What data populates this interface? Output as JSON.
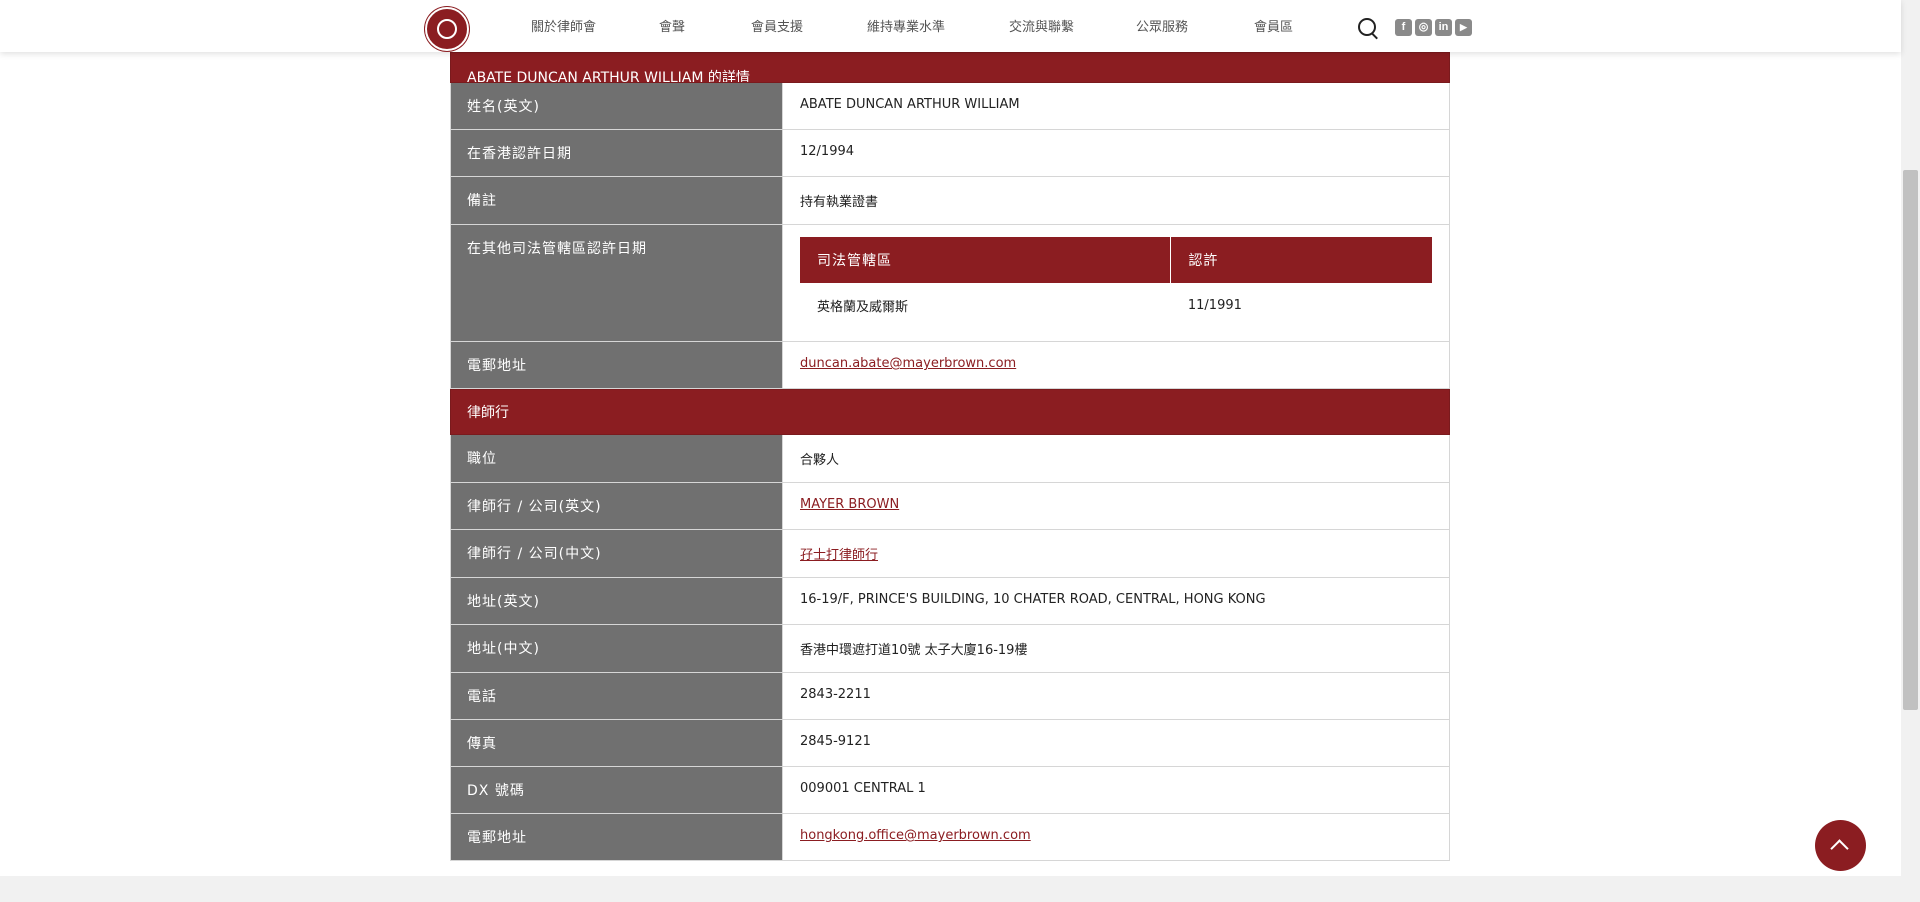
{
  "nav": {
    "items": [
      "關於律師會",
      "會聲",
      "會員支援",
      "維持專業水準",
      "交流與聯繫",
      "公眾服務",
      "會員區"
    ],
    "social": [
      "f",
      "◎",
      "in",
      "▶"
    ]
  },
  "profile": {
    "heading": "ABATE DUNCAN ARTHUR WILLIAM 的詳情",
    "rows": [
      {
        "label": "姓名(英文)",
        "value": "ABATE DUNCAN ARTHUR WILLIAM"
      },
      {
        "label": "在香港認許日期",
        "value": "12/1994"
      },
      {
        "label": "備註",
        "value": "持有執業證書"
      }
    ],
    "other_jurisdictions": {
      "label": "在其他司法管轄區認許日期",
      "col_jurisdiction": "司法管轄區",
      "col_admission": "認許",
      "entries": [
        {
          "jurisdiction": "英格蘭及威爾斯",
          "admission": "11/1991"
        }
      ]
    },
    "email": {
      "label": "電郵地址",
      "value": "duncan.abate@mayerbrown.com"
    }
  },
  "firm": {
    "heading": "律師行",
    "position": {
      "label": "職位",
      "value": "合夥人"
    },
    "name_en": {
      "label": "律師行 / 公司(英文)",
      "value": "MAYER BROWN"
    },
    "name_zh": {
      "label": "律師行 / 公司(中文)",
      "value": "孖士打律師行"
    },
    "addr_en": {
      "label": "地址(英文)",
      "value": "16-19/F, PRINCE'S BUILDING, 10 CHATER ROAD, CENTRAL, HONG KONG"
    },
    "addr_zh": {
      "label": "地址(中文)",
      "value": "香港中環遮打道10號 太子大廈16-19樓"
    },
    "phone": {
      "label": "電話",
      "value": "2843-2211"
    },
    "fax": {
      "label": "傳真",
      "value": "2845-9121"
    },
    "dx": {
      "label": "DX 號碼",
      "value": "009001 CENTRAL 1"
    },
    "email": {
      "label": "電郵地址",
      "value": "hongkong.office@mayerbrown.com"
    }
  }
}
